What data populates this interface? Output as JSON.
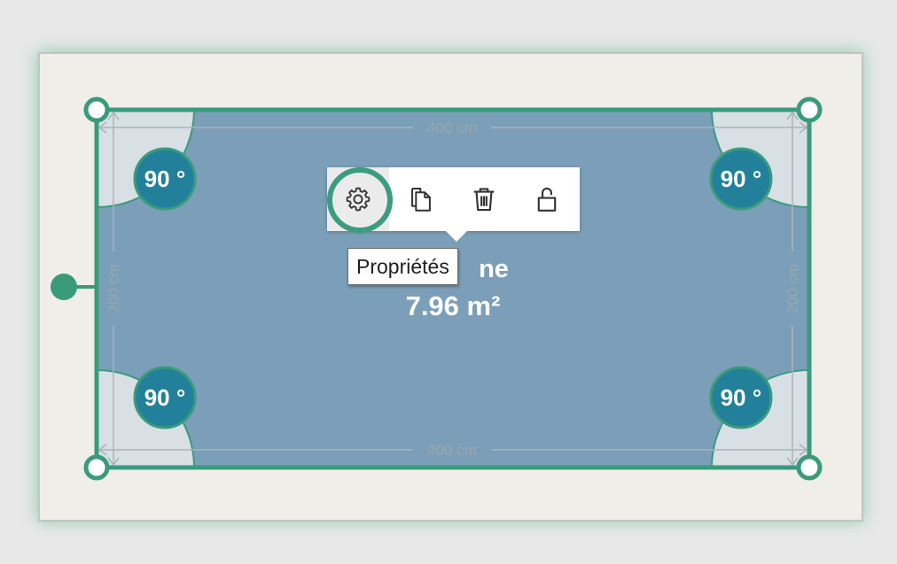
{
  "room": {
    "name_visible": "ne",
    "area": "7.96 m²",
    "dimensions": {
      "top": "400 cm",
      "bottom": "400 cm",
      "left": "200 cm",
      "right": "200 cm"
    },
    "corner_angles": [
      "90 °",
      "90 °",
      "90 °",
      "90 °"
    ]
  },
  "toolbar": {
    "buttons": [
      {
        "name": "properties",
        "icon": "gear-icon",
        "active": true
      },
      {
        "name": "duplicate",
        "icon": "copy-icon",
        "active": false
      },
      {
        "name": "delete",
        "icon": "trash-icon",
        "active": false
      },
      {
        "name": "lock",
        "icon": "unlock-icon",
        "active": false
      }
    ],
    "tooltip": "Propriétés"
  },
  "colors": {
    "canvas": "#efeee8",
    "room_fill": "#7b9fb8",
    "wall": "#3a9b7c",
    "angle_badge": "#22809a",
    "corner_sector": "#d8e0e6",
    "dimension_text": "#9aa6ad"
  }
}
